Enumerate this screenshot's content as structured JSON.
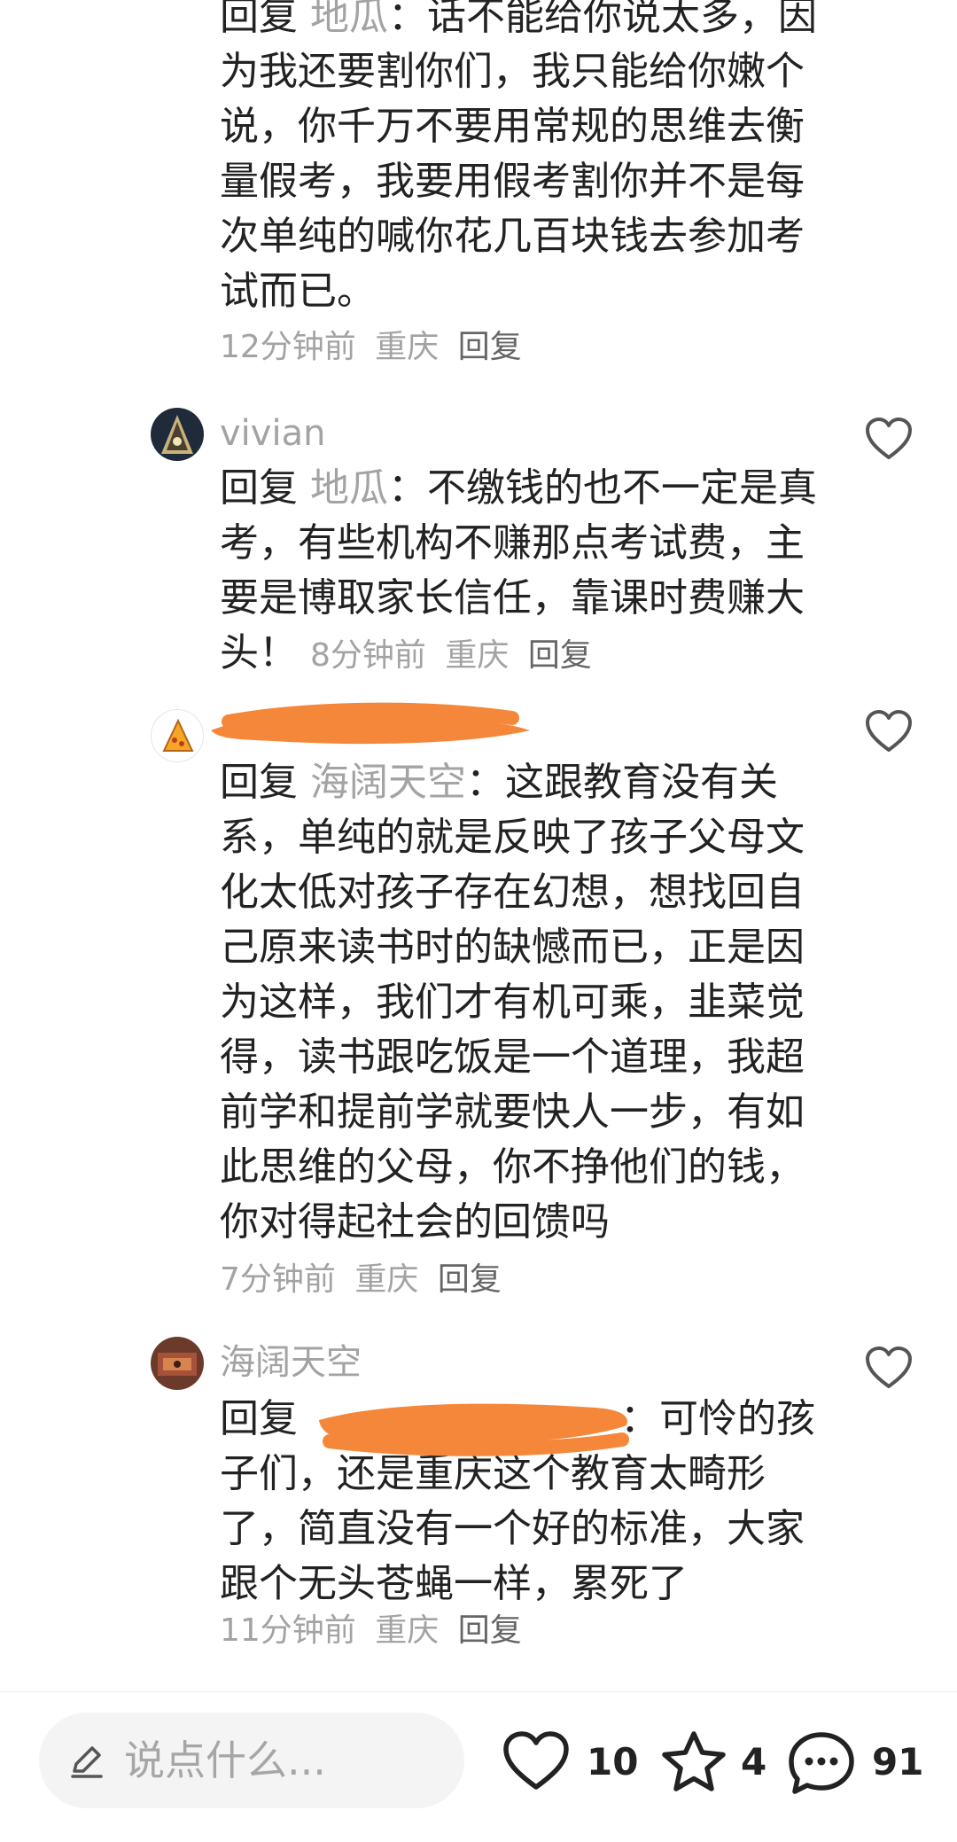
{
  "comments": [
    {
      "reply_label": "回复",
      "reply_to": "地瓜",
      "colon": "：",
      "text": "话不能给你说太多，因为我还要割你们，我只能给你嫩个说，你千万不要用常规的思维去衡量假考，我要用假考割你并不是每次单纯的喊你花几百块钱去参加考试而已。",
      "time": "12分钟前",
      "location": "重庆",
      "reply_action": "回复"
    },
    {
      "username": "vivian",
      "reply_label": "回复",
      "reply_to": "地瓜",
      "colon": "：",
      "text": "不缴钱的也不一定是真考，有些机构不赚那点考试费，主要是博取家长信任，靠课时费赚大头！",
      "time": "8分钟前",
      "location": "重庆",
      "reply_action": "回复"
    },
    {
      "reply_label": "回复",
      "reply_to": "海阔天空",
      "colon": "：",
      "text": "这跟教育没有关系，单纯的就是反映了孩子父母文化太低对孩子存在幻想，想找回自己原来读书时的缺憾而已，正是因为这样，我们才有机可乘，韭菜觉得，读书跟吃饭是一个道理，我超前学和提前学就要快人一步，有如此思维的父母，你不挣他们的钱，你对得起社会的回馈吗",
      "time": "7分钟前",
      "location": "重庆",
      "reply_action": "回复"
    },
    {
      "username": "海阔天空",
      "reply_label": "回复",
      "colon": "：",
      "text": "可怜的孩子们，还是重庆这个教育太畸形了，简直没有一个好的标准，大家跟个无头苍蝇一样，累死了",
      "time": "11分钟前",
      "location": "重庆",
      "reply_action": "回复"
    }
  ],
  "bottom_bar": {
    "input_placeholder": "说点什么...",
    "like_count": "10",
    "favorite_count": "4",
    "comment_count": "91"
  },
  "icons": {
    "like": "heart-icon",
    "favorite": "star-icon",
    "comment": "chat-bubble-icon",
    "edit": "pen-icon"
  },
  "colors": {
    "scribble": "#f5873a",
    "muted_text": "#a3a3a3"
  }
}
